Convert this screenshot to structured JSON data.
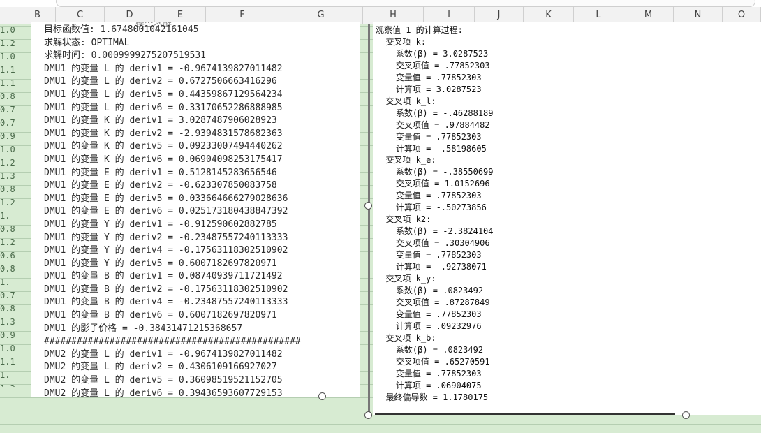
{
  "columns": [
    "B",
    "C",
    "D",
    "E",
    "F",
    "G",
    "H",
    "I",
    "J",
    "K",
    "L",
    "M",
    "N",
    "O"
  ],
  "row_fragments": [
    "1.0",
    "1.2",
    "1.0",
    "1.1",
    "1.1",
    "0.8",
    "0.7",
    "0.7",
    "0.9",
    "1.0",
    "1.2",
    "1.3",
    "0.8",
    "1.2",
    "1.",
    "0.8",
    "1.2",
    "0.6",
    "0.8",
    "1.",
    "0.7",
    "0.8",
    "1.3",
    "0.9",
    "1.0",
    "1.1",
    "1.",
    "1.2"
  ],
  "left_panel": {
    "title": "模型求解",
    "lines": [
      "目标函数值: 1.6748001042161045",
      "求解状态: OPTIMAL",
      "求解时间: 0.0009999275207519531",
      "DMU1 的变量 L 的 deriv1 = -0.9674139827011482",
      "DMU1 的变量 L 的 deriv2 = 0.6727506663416296",
      "DMU1 的变量 L 的 deriv5 = 0.44359867129564234",
      "DMU1 的变量 L 的 deriv6 = 0.33170652286888985",
      "DMU1 的变量 K 的 deriv1 = 3.0287487906028923",
      "DMU1 的变量 K 的 deriv2 = -2.9394831578682363",
      "DMU1 的变量 K 的 deriv5 = 0.09233007494440262",
      "DMU1 的变量 K 的 deriv6 = 0.06904098253175417",
      "DMU1 的变量 E 的 deriv1 = 0.5128145283656546",
      "DMU1 的变量 E 的 deriv2 = -0.623307850083758",
      "DMU1 的变量 E 的 deriv5 = 0.033664666279028636",
      "DMU1 的变量 E 的 deriv6 = 0.025173180438847392",
      "DMU1 的变量 Y 的 deriv1 = -0.912590602882785",
      "DMU1 的变量 Y 的 deriv2 = -0.23487557240113333",
      "DMU1 的变量 Y 的 deriv4 = -0.17563118302510902",
      "DMU1 的变量 Y 的 deriv5 = 0.6007182697820971",
      "DMU1 的变量 B 的 deriv1 = 0.08740939711721492",
      "DMU1 的变量 B 的 deriv2 = -0.17563118302510902",
      "DMU1 的变量 B 的 deriv4 = -0.23487557240113333",
      "DMU1 的变量 B 的 deriv6 = 0.6007182697820971",
      "DMU1 的影子价格 = -0.38431471215368657",
      "###############################################",
      "DMU2 的变量 L 的 deriv1 = -0.9674139827011482",
      "DMU2 的变量 L 的 deriv2 = 0.4306109166927027",
      "DMU2 的变量 L 的 deriv5 = 0.36098519521152705",
      "DMU2 的变量 L 的 deriv6 = 0.39436593607729153"
    ]
  },
  "right_panel": {
    "lines": [
      "观察值 1 的计算过程:",
      "  交叉项 k:",
      "    系数(β) = 3.0287523",
      "    交叉项值 = .77852303",
      "    变量值 = .77852303",
      "    计算项 = 3.0287523",
      "  交叉项 k_l:",
      "    系数(β) = -.46288189",
      "    交叉项值 = .97884482",
      "    变量值 = .77852303",
      "    计算项 = -.58198605",
      "  交叉项 k_e:",
      "    系数(β) = -.38550699",
      "    交叉项值 = 1.0152696",
      "    变量值 = .77852303",
      "    计算项 = -.50273856",
      "  交叉项 k2:",
      "    系数(β) = -2.3824104",
      "    交叉项值 = .30304906",
      "    变量值 = .77852303",
      "    计算项 = -.92738071",
      "  交叉项 k_y:",
      "    系数(β) = .0823492",
      "    交叉项值 = .87287849",
      "    变量值 = .77852303",
      "    计算项 = .09232976",
      "  交叉项 k_b:",
      "    系数(β) = .0823492",
      "    交叉项值 = .65270591",
      "    变量值 = .77852303",
      "    计算项 = .06904075",
      "  最终偏导数 = 1.1780175"
    ]
  }
}
